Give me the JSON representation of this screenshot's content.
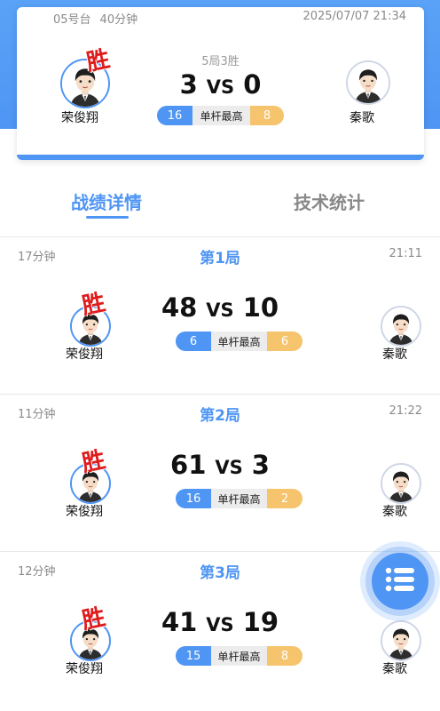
{
  "colors": {
    "accent": "#4f95f4",
    "win": "#e01b1b",
    "highlight_right": "#f5c46d"
  },
  "summary": {
    "table": "05号台",
    "duration": "40分钟",
    "datetime": "2025/07/07 21:34",
    "format": "5局3胜",
    "score_left": "3",
    "vs": "VS",
    "score_right": "0",
    "high_left": "16",
    "high_label": "单杆最高",
    "high_right": "8",
    "win_label": "胜",
    "player_left": "荣俊翔",
    "player_right": "秦歌",
    "avatar_icon": "player-avatar-icon"
  },
  "tabs": [
    {
      "label": "战绩详情",
      "active": true
    },
    {
      "label": "技术统计",
      "active": false
    }
  ],
  "rounds": [
    {
      "duration": "17分钟",
      "title": "第1局",
      "time": "21:11",
      "score_left": "48",
      "vs": "VS",
      "score_right": "10",
      "high_left": "6",
      "high_label": "单杆最高",
      "high_right": "6",
      "win_label": "胜",
      "player_left": "荣俊翔",
      "player_right": "秦歌"
    },
    {
      "duration": "11分钟",
      "title": "第2局",
      "time": "21:22",
      "score_left": "61",
      "vs": "VS",
      "score_right": "3",
      "high_left": "16",
      "high_label": "单杆最高",
      "high_right": "2",
      "win_label": "胜",
      "player_left": "荣俊翔",
      "player_right": "秦歌"
    },
    {
      "duration": "12分钟",
      "title": "第3局",
      "time": "",
      "score_left": "41",
      "vs": "VS",
      "score_right": "19",
      "high_left": "15",
      "high_label": "单杆最高",
      "high_right": "8",
      "win_label": "胜",
      "player_left": "荣俊翔",
      "player_right": "秦歌"
    }
  ],
  "fab": {
    "icon": "list-menu-icon"
  }
}
